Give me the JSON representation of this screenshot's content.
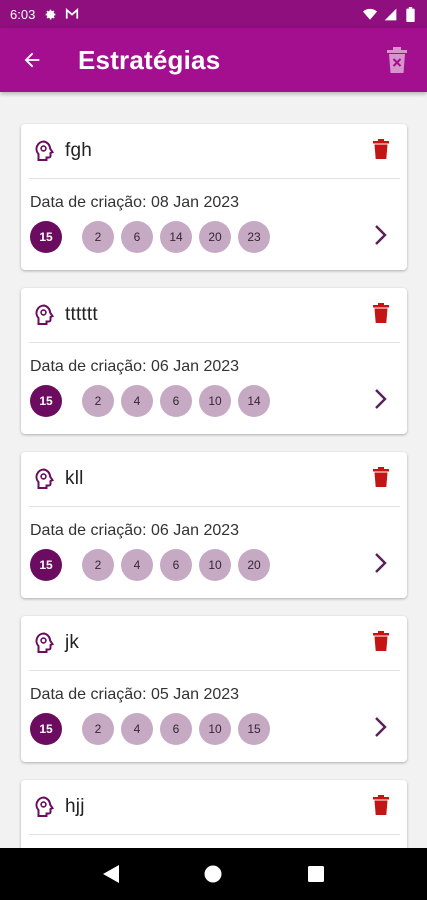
{
  "status_bar": {
    "time": "6:03",
    "icons": [
      "gear-icon",
      "gmail-icon",
      "wifi-icon",
      "signal-icon",
      "battery-icon"
    ]
  },
  "app_bar": {
    "title": "Estratégias",
    "back_icon": "arrow-left-icon",
    "action_icon": "delete-all-icon"
  },
  "colors": {
    "app_bar": "#a40f8f",
    "status_bar": "#8e0f7d",
    "main_ball": "#6b0c60",
    "number_ball": "#c6aac4",
    "delete": "#c41414",
    "chevron": "#5a1f5a"
  },
  "date_prefix": "Data de criação:",
  "cards": [
    {
      "name": "fgh",
      "date": "08 Jan 2023",
      "main": "15",
      "numbers": [
        "2",
        "6",
        "14",
        "20",
        "23"
      ]
    },
    {
      "name": "tttttt",
      "date": "06 Jan 2023",
      "main": "15",
      "numbers": [
        "2",
        "4",
        "6",
        "10",
        "14"
      ]
    },
    {
      "name": "kll",
      "date": "06 Jan 2023",
      "main": "15",
      "numbers": [
        "2",
        "4",
        "6",
        "10",
        "20"
      ]
    },
    {
      "name": "jk",
      "date": "05 Jan 2023",
      "main": "15",
      "numbers": [
        "2",
        "4",
        "6",
        "10",
        "15"
      ]
    },
    {
      "name": "hjj",
      "date": "",
      "main": "",
      "numbers": []
    }
  ],
  "nav_bar": {
    "icons": [
      "back-triangle-icon",
      "home-circle-icon",
      "recents-square-icon"
    ]
  }
}
